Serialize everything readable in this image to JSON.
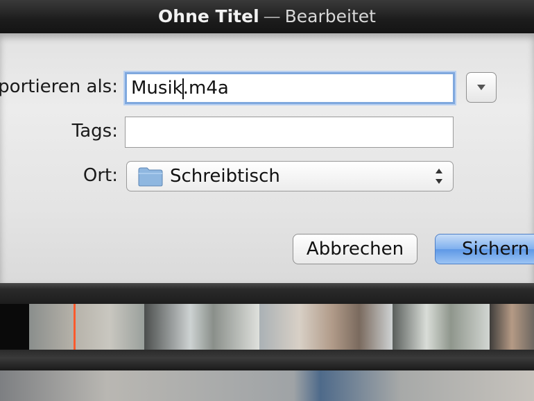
{
  "window": {
    "title": "Ohne Titel",
    "separator": "—",
    "state": "Bearbeitet"
  },
  "dialog": {
    "export_label": "portieren als:",
    "filename_before_caret": "Musik",
    "filename_after_caret": ".m4a",
    "tags_label": "Tags:",
    "tags_value": "",
    "location_label": "Ort:",
    "location_value": "Schreibtisch",
    "cancel_label": "Abbrechen",
    "save_label": "Sichern"
  },
  "icons": {
    "disclosure": "triangle-down-icon",
    "folder": "folder-icon",
    "popup_arrows": "up-down-arrows-icon"
  },
  "colors": {
    "focus_ring": "#7fa8de",
    "default_button": "#7fb0ee",
    "playhead": "#ff5a2c"
  }
}
